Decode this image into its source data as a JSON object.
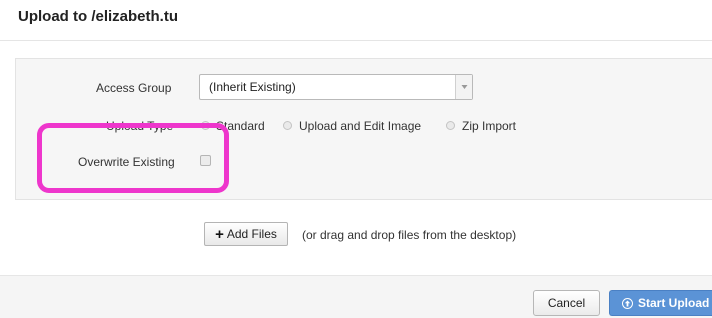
{
  "dialog": {
    "title": "Upload to /elizabeth.tu"
  },
  "form": {
    "access_group": {
      "label": "Access Group",
      "value": "(Inherit Existing)"
    },
    "upload_type": {
      "label": "Upload Type",
      "options": [
        {
          "label": "Standard",
          "selected": false
        },
        {
          "label": "Upload and Edit Image",
          "selected": false
        },
        {
          "label": "Zip Import",
          "selected": false
        }
      ]
    },
    "overwrite_existing": {
      "label": "Overwrite Existing",
      "checked": false
    }
  },
  "files": {
    "add_files_label": "Add Files",
    "drop_hint": "(or drag and drop files from the desktop)"
  },
  "footer": {
    "cancel_label": "Cancel",
    "start_upload_label": "Start Upload"
  },
  "annotation": {
    "highlight_color": "#ee36cc"
  },
  "colors": {
    "primary_button": "#5b93d6"
  },
  "icons": [
    "chevron-down-icon",
    "plus-icon",
    "upload-icon"
  ]
}
